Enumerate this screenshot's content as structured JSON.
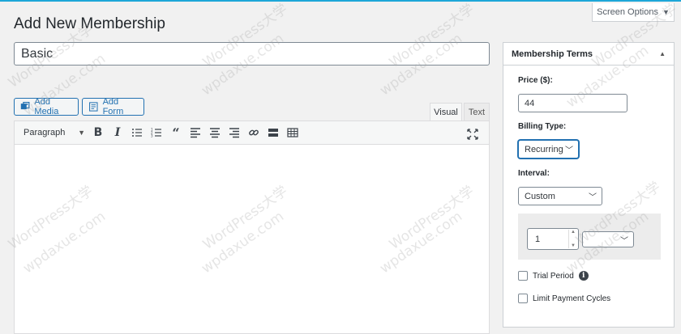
{
  "screen_options": {
    "label": "Screen Options"
  },
  "page": {
    "title": "Add New Membership"
  },
  "title_field": {
    "value": "Basic"
  },
  "media_buttons": {
    "add_media": "Add Media",
    "add_form": "Add Form"
  },
  "editor": {
    "tabs": {
      "visual": "Visual",
      "text": "Text"
    },
    "format_select": "Paragraph"
  },
  "membership_terms": {
    "heading": "Membership Terms",
    "price_label": "Price ($):",
    "price_value": "44",
    "billing_type_label": "Billing Type:",
    "billing_type_value": "Recurring",
    "interval_label": "Interval:",
    "interval_value": "Custom",
    "interval_number": "1",
    "interval_unit": "",
    "trial_period_label": "Trial Period",
    "limit_cycles_label": "Limit Payment Cycles"
  },
  "watermark": {
    "domain": "wpdaxue.com",
    "brand": "WordPress大学"
  },
  "colors": {
    "accent": "#2271b1",
    "top_bar": "#1ea7d8"
  }
}
